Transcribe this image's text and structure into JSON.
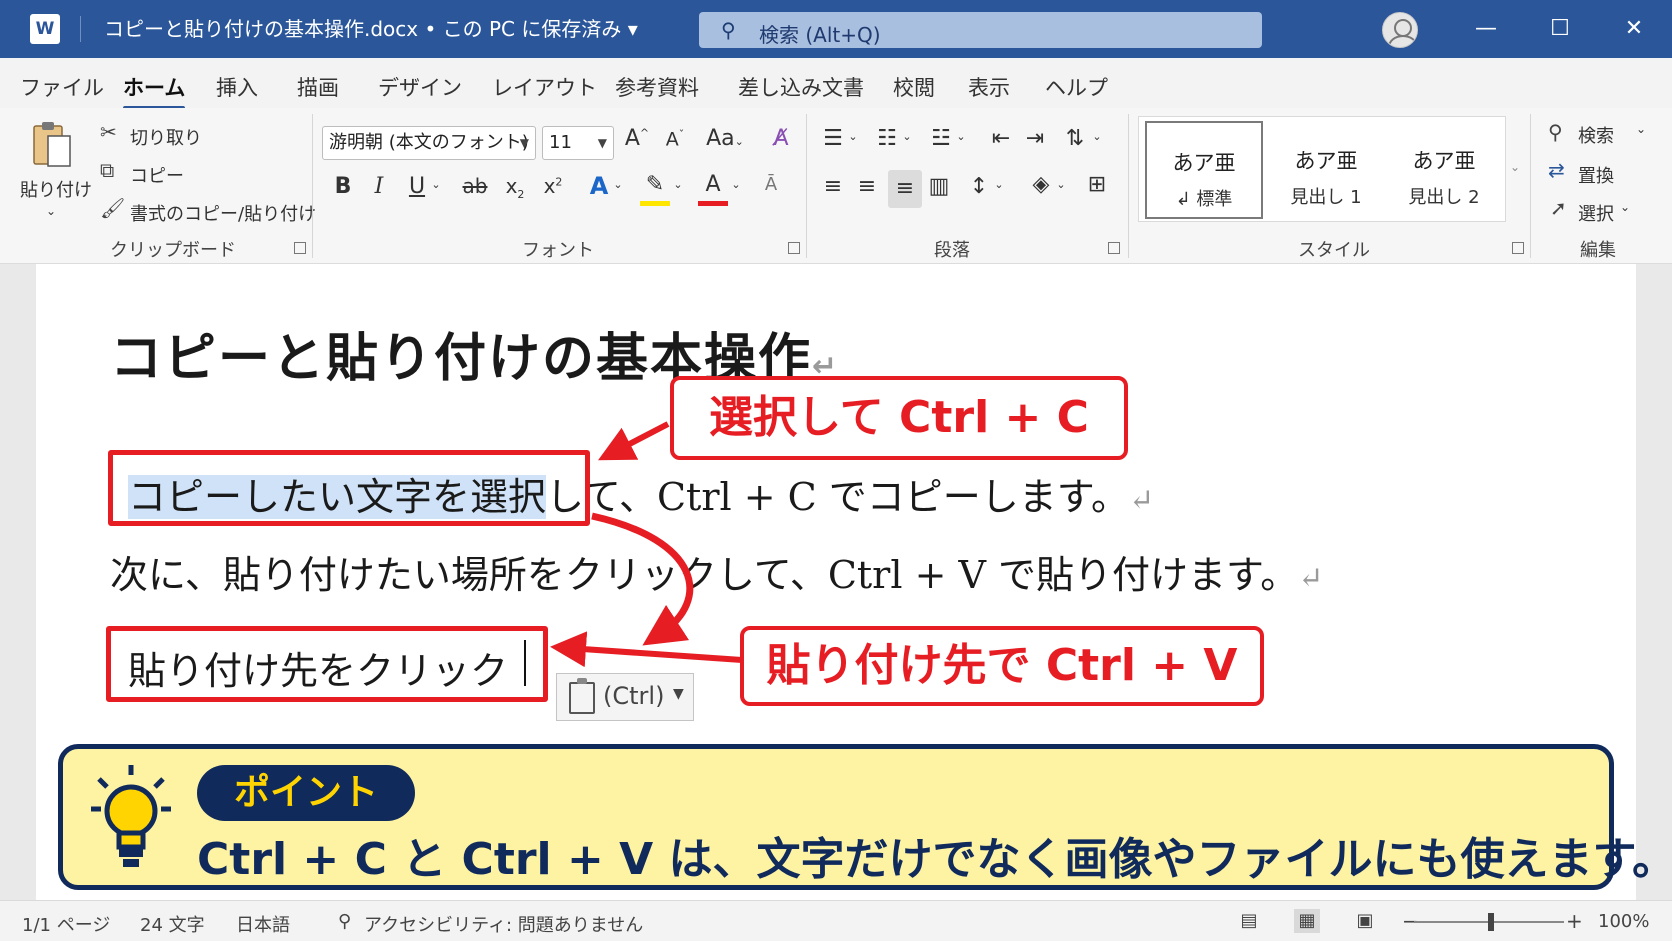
{
  "titlebar": {
    "app_logo": "W",
    "document_title": "コピーと貼り付けの基本操作.docx  •  この PC に保存済み  ▾",
    "search_placeholder": "検索 (Alt+Q)",
    "minimize": "—",
    "maximize": "☐",
    "close": "✕"
  },
  "tabs": [
    {
      "label": "ファイル",
      "active": false
    },
    {
      "label": "ホーム",
      "active": true
    },
    {
      "label": "挿入",
      "active": false
    },
    {
      "label": "描画",
      "active": false
    },
    {
      "label": "デザイン",
      "active": false
    },
    {
      "label": "レイアウト",
      "active": false
    },
    {
      "label": "参考資料",
      "active": false
    },
    {
      "label": "差し込み文書",
      "active": false
    },
    {
      "label": "校閲",
      "active": false
    },
    {
      "label": "表示",
      "active": false
    },
    {
      "label": "ヘルプ",
      "active": false
    }
  ],
  "ribbon": {
    "clipboard": {
      "paste": "貼り付け",
      "cut": "切り取り",
      "copy": "コピー",
      "format_painter": "書式のコピー/貼り付け",
      "label": "クリップボード"
    },
    "font": {
      "font_name": "游明朝 (本文のフォント)",
      "font_size": "11",
      "label": "フォント"
    },
    "paragraph": {
      "label": "段落"
    },
    "styles": {
      "label": "スタイル",
      "items": [
        {
          "preview": "あア亜",
          "name": "標準",
          "selected": true
        },
        {
          "preview": "あア亜",
          "name": "見出し 1",
          "selected": false
        },
        {
          "preview": "あア亜",
          "name": "見出し 2",
          "selected": false
        }
      ]
    },
    "editing": {
      "find": "検索",
      "replace": "置換",
      "select": "選択",
      "label": "編集"
    }
  },
  "document": {
    "heading": "コピーと貼り付けの基本操作",
    "line1_selected": "コピーしたい文字を選択",
    "line1_rest": "して、Ctrl + C でコピーします。",
    "line2": "次に、貼り付けたい場所をクリックして、Ctrl + V で貼り付けます。",
    "line3": "貼り付け先をクリック",
    "paste_options": "(Ctrl)",
    "callout_copy": "選択して Ctrl + C",
    "callout_paste": "貼り付け先で Ctrl + V",
    "paragraph_mark": "↵"
  },
  "point": {
    "badge": "ポイント",
    "text": "Ctrl + C と Ctrl + V は、文字だけでなく画像やファイルにも使えます。"
  },
  "statusbar": {
    "page": "1/1 ページ",
    "words": "24 文字",
    "language": "日本語",
    "accessibility": "アクセシビリティ: 問題ありません",
    "zoom": "100%"
  },
  "colors": {
    "word_blue": "#2b579a",
    "annotation_red": "#e61e24",
    "point_navy": "#102a5c",
    "point_yellow": "#fdf3a3",
    "selection": "#cfe2f7"
  }
}
